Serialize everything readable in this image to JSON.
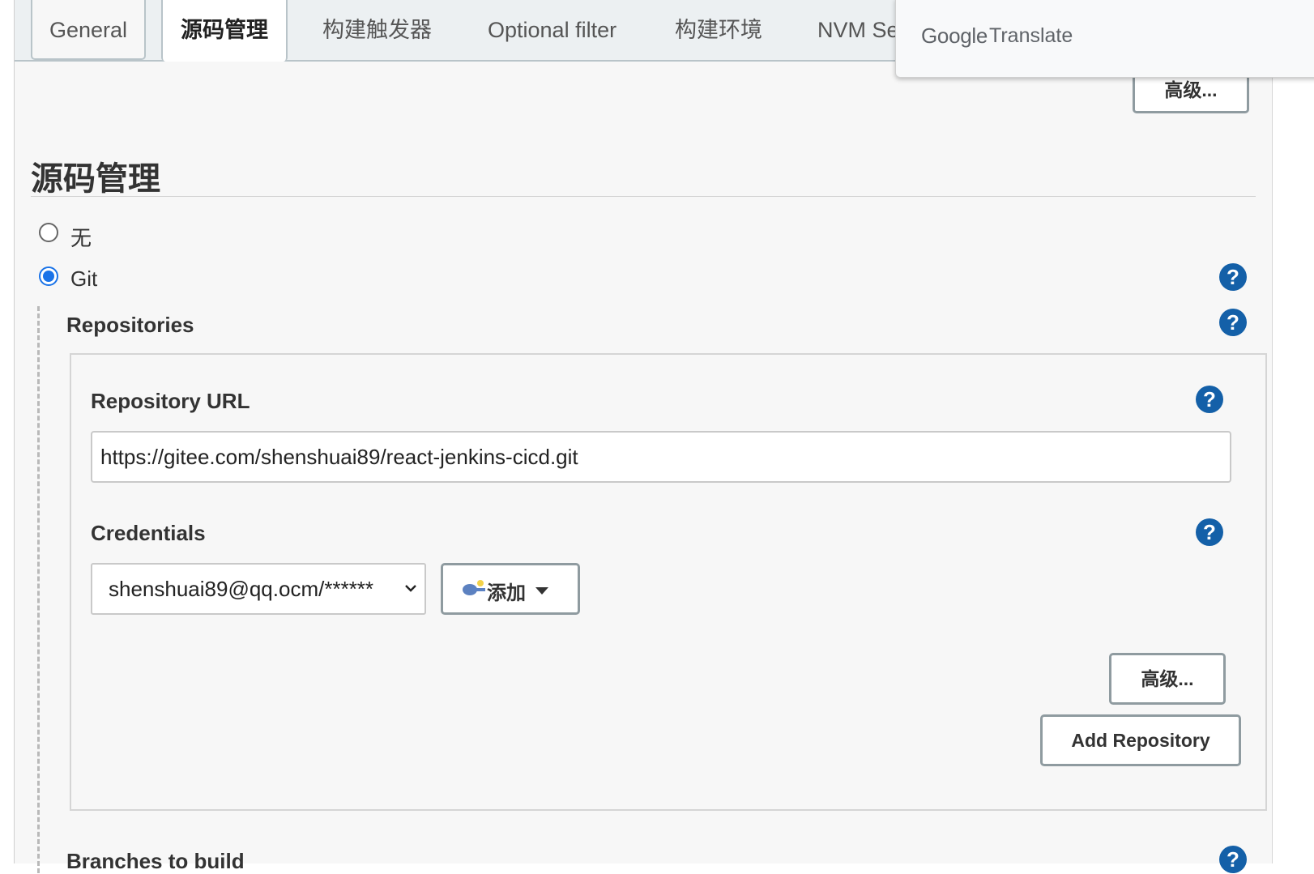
{
  "tabs": [
    {
      "label": "General"
    },
    {
      "label": "源码管理"
    },
    {
      "label": "构建触发器"
    },
    {
      "label": "Optional filter"
    },
    {
      "label": "构建环境"
    },
    {
      "label": "NVM Se"
    }
  ],
  "top_advanced_label": "高级...",
  "section": {
    "title": "源码管理",
    "radio_none": "无",
    "radio_git": "Git"
  },
  "repositories": {
    "title": "Repositories",
    "url_label": "Repository URL",
    "url_value": "https://gitee.com/shenshuai89/react-jenkins-cicd.git",
    "credentials_label": "Credentials",
    "credentials_selected": "shenshuai89@qq.ocm/******",
    "add_label": "添加",
    "advanced_label": "高级...",
    "add_repo_label": "Add Repository"
  },
  "branches_label": "Branches to build",
  "popup": {
    "google": "Google",
    "translate": "Translate"
  },
  "icons": {
    "help": "help-icon",
    "key": "key-icon",
    "dropdown": "chevron-down-icon"
  },
  "colors": {
    "help_blue": "#1460a8",
    "radio_blue": "#1a73e8",
    "button_border": "#8f9ba0",
    "panel_bg": "#f7f7f7",
    "tabbar_bg": "#ecf0f2"
  }
}
